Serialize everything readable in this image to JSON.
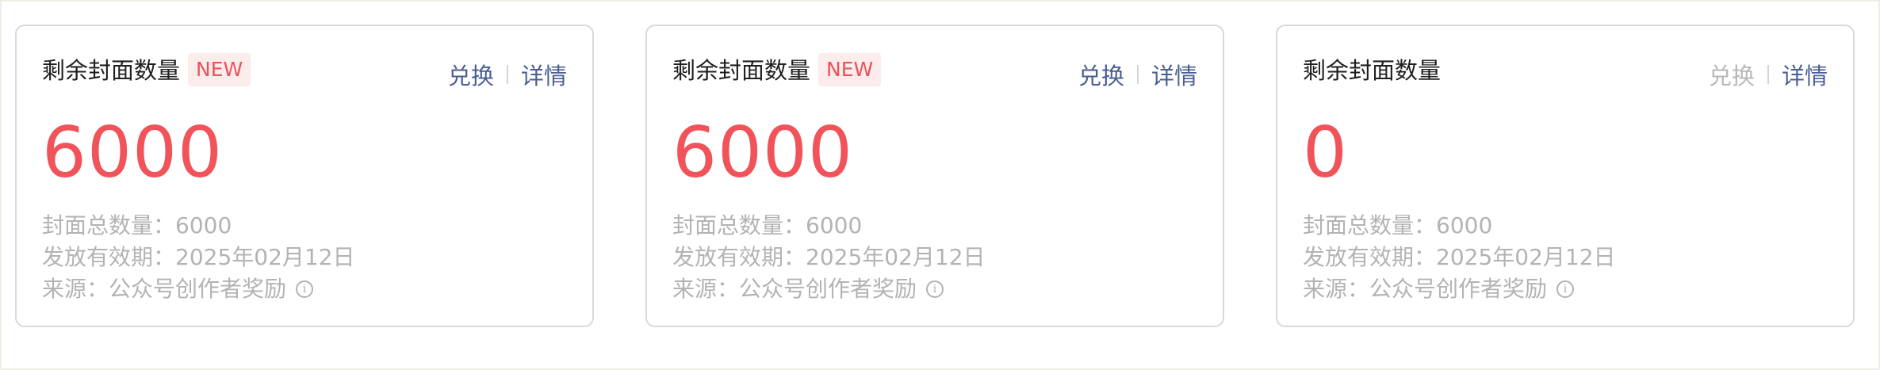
{
  "cards": [
    {
      "title": "剩余封面数量",
      "badge": "NEW",
      "exchange_label": "兑换",
      "detail_label": "详情",
      "remaining": "6000",
      "total_line": "封面总数量：6000",
      "validity_line": "发放有效期：2025年02月12日",
      "source_line": "来源：公众号创作者奖励",
      "info_icon_glyph": "i"
    },
    {
      "title": "剩余封面数量",
      "badge": "NEW",
      "exchange_label": "兑换",
      "detail_label": "详情",
      "remaining": "6000",
      "total_line": "封面总数量：6000",
      "validity_line": "发放有效期：2025年02月12日",
      "source_line": "来源：公众号创作者奖励",
      "info_icon_glyph": "i"
    },
    {
      "title": "剩余封面数量",
      "exchange_label": "兑换",
      "detail_label": "详情",
      "remaining": "0",
      "total_line": "封面总数量：6000",
      "validity_line": "发放有效期：2025年02月12日",
      "source_line": "来源：公众号创作者奖励",
      "info_icon_glyph": "i"
    }
  ],
  "colors": {
    "accent_number": "#f0545a",
    "badge_text": "#e8545a",
    "badge_bg": "#fdecec",
    "link": "#4a5f92",
    "link_disabled": "#b8b8b8",
    "muted_text": "#b3b3b3",
    "card_border": "#d9d9de"
  }
}
